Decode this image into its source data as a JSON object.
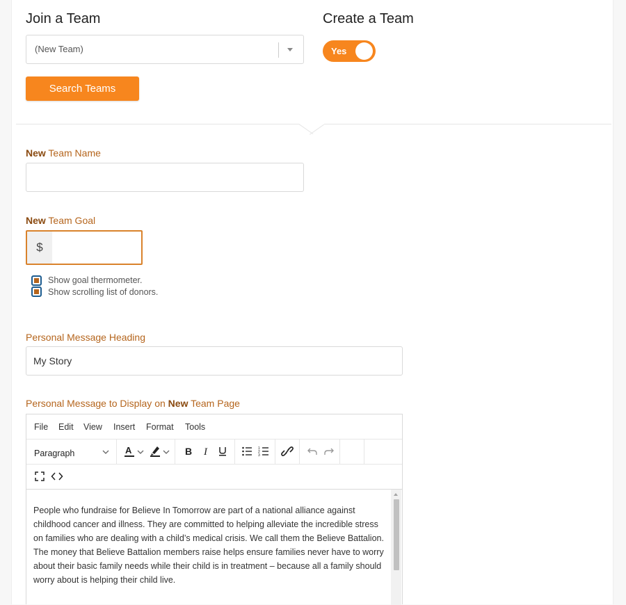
{
  "join": {
    "title": "Join a Team",
    "select_value": "(New Team)",
    "search_button": "Search Teams"
  },
  "create": {
    "title": "Create a Team",
    "toggle_label": "Yes",
    "toggle_on": true
  },
  "team_name": {
    "label_bold": "New",
    "label_rest": " Team Name",
    "value": ""
  },
  "team_goal": {
    "label_bold": "New",
    "label_rest": " Team Goal",
    "currency_symbol": "$",
    "value": ""
  },
  "options": [
    {
      "label": "Show goal thermometer.",
      "checked": true
    },
    {
      "label": "Show scrolling list of donors.",
      "checked": true
    }
  ],
  "message_heading": {
    "label": "Personal Message Heading",
    "value": "My Story"
  },
  "message": {
    "label_pre": "Personal Message to Display on ",
    "label_bold": "New",
    "label_post": " Team Page",
    "menus": [
      "File",
      "Edit",
      "View",
      "Insert",
      "Format",
      "Tools"
    ],
    "block_format": "Paragraph",
    "body": "People who fundraise for Believe In Tomorrow are part of a national alliance against childhood cancer and illness. They are committed to helping alleviate the incredible stress on families who are dealing with a child’s medical crisis. We call them the Believe Battalion. The money that Believe Battalion members raise helps ensure families never have to worry about their basic family needs while their child is in treatment – because all a family should worry about is helping their child live."
  },
  "colors": {
    "accent": "#f7861e",
    "label": "#b5651d",
    "label_bold": "#8a4a10",
    "checkbox_border": "#1d5c8f"
  },
  "icons": {
    "select_caret": "chevron-down-icon",
    "text_color": "text-color-icon",
    "highlight": "highlight-pen-icon",
    "bold": "bold-icon",
    "italic": "italic-icon",
    "underline": "underline-icon",
    "bullet_list": "bullet-list-icon",
    "numbered_list": "numbered-list-icon",
    "link": "link-icon",
    "undo": "undo-icon",
    "redo": "redo-icon",
    "fullscreen": "fullscreen-icon",
    "source_code": "source-code-icon"
  }
}
